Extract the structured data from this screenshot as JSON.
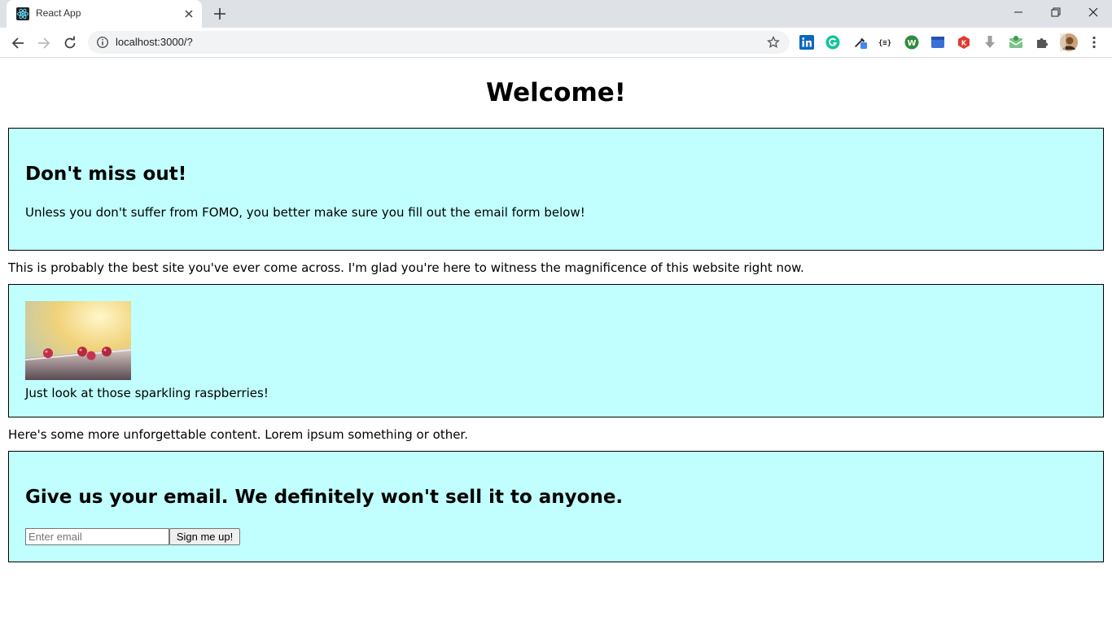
{
  "browser": {
    "tab_title": "React App",
    "url": "localhost:3000/?"
  },
  "page": {
    "heading": "Welcome!",
    "fomo_box": {
      "title": "Don't miss out!",
      "text": "Unless you don't suffer from FOMO, you better make sure you fill out the email form below!"
    },
    "intro_text": "This is probably the best site you've ever come across. I'm glad you're here to witness the magnificence of this website right now.",
    "image_box": {
      "caption": "Just look at those sparkling raspberries!"
    },
    "more_text": "Here's some more unforgettable content. Lorem ipsum something or other.",
    "email_box": {
      "title": "Give us your email. We definitely won't sell it to anyone.",
      "email_placeholder": "Enter email",
      "email_value": "",
      "button_label": "Sign me up!"
    }
  },
  "colors": {
    "card_background": "#c0fffd",
    "card_border": "#000000"
  },
  "icons": {
    "toolbar_extensions": [
      "linkedin-icon",
      "grammarly-icon",
      "color-picker-icon",
      "json-viewer-icon",
      "wordpress-icon",
      "screen-capture-icon",
      "pdf-icon",
      "download-icon",
      "mail-icon",
      "extensions-puzzle-icon",
      "profile-avatar",
      "menu-icon"
    ]
  }
}
